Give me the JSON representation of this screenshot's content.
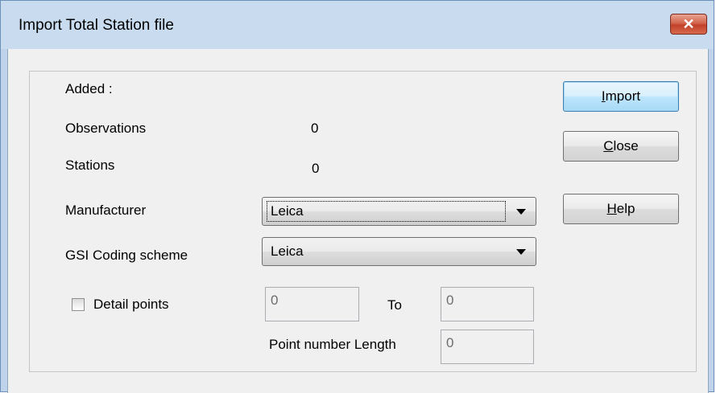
{
  "window": {
    "title": "Import Total Station file",
    "close_glyph": "✕"
  },
  "added": {
    "heading": "Added :",
    "observations_label": "Observations",
    "observations_value": "0",
    "stations_label": "Stations",
    "stations_value": "0"
  },
  "manufacturer": {
    "label": "Manufacturer",
    "value": "Leica"
  },
  "gsi_coding": {
    "label": "GSI Coding scheme",
    "value": "Leica"
  },
  "detail_points": {
    "label": "Detail points",
    "checked": false,
    "from_value": "0",
    "to_label": "To",
    "to_value": "0",
    "point_number_length_label": "Point number Length",
    "point_number_length_value": "0"
  },
  "buttons": {
    "import": {
      "mnemonic": "I",
      "rest": "mport"
    },
    "close": {
      "mnemonic": "C",
      "rest": "lose"
    },
    "help": {
      "mnemonic": "H",
      "rest": "elp"
    }
  },
  "colors": {
    "close_button": "#c1412a",
    "title_bar": "#c9dcef",
    "default_button_border": "#3c7fb1"
  }
}
